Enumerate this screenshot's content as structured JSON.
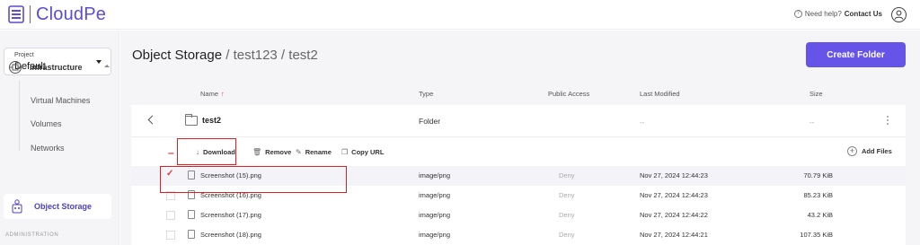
{
  "app": {
    "name": "CloudPe",
    "help_text": "Need help?",
    "help_link": "Contact Us"
  },
  "sidebar": {
    "project_label": "Project",
    "project_value": "Default",
    "infrastructure": "Infrastructure",
    "items": [
      "Virtual Machines",
      "Volumes",
      "Networks"
    ],
    "object_storage": "Object Storage",
    "administration": "ADMINISTRATION"
  },
  "main": {
    "title": "Object Storage",
    "breadcrumb": " / test123 / test2",
    "create_button": "Create Folder",
    "columns": {
      "name": "Name",
      "type": "Type",
      "public_access": "Public Access",
      "last_modified": "Last Modified",
      "size": "Size"
    },
    "folder": {
      "name": "test2",
      "type": "Folder",
      "modified": "--",
      "size": "--"
    },
    "toolbar": {
      "download": "Download",
      "remove": "Remove",
      "rename": "Rename",
      "copy_url": "Copy URL",
      "add_files": "Add Files"
    },
    "files": [
      {
        "name": "Screenshot (15).png",
        "type": "image/png",
        "access": "Deny",
        "modified": "Nov 27, 2024 12:44:23",
        "size": "70.79 KiB",
        "selected": true
      },
      {
        "name": "Screenshot (16).png",
        "type": "image/png",
        "access": "Deny",
        "modified": "Nov 27, 2024 12:44:23",
        "size": "85.23 KiB",
        "selected": false
      },
      {
        "name": "Screenshot (17).png",
        "type": "image/png",
        "access": "Deny",
        "modified": "Nov 27, 2024 12:44:22",
        "size": "43.2 KiB",
        "selected": false
      },
      {
        "name": "Screenshot (18).png",
        "type": "image/png",
        "access": "Deny",
        "modified": "Nov 27, 2024 12:44:21",
        "size": "107.35 KiB",
        "selected": false
      }
    ]
  },
  "colors": {
    "brand": "#5a4bd8",
    "primary_button": "#6654e8",
    "highlight": "#e02020"
  }
}
